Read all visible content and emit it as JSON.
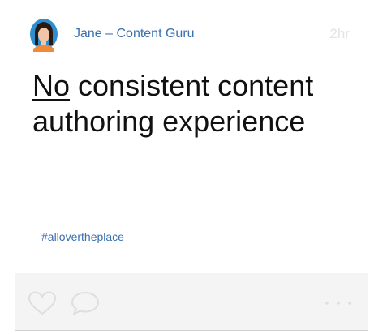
{
  "post": {
    "author": "Jane – Content Guru",
    "time": "2hr",
    "headline_emphasis": "No",
    "headline_rest": " consistent content authoring experience",
    "hashtag": "#allovertheplace"
  },
  "icons": {
    "avatar": "avatar-woman-icon",
    "like": "heart-icon",
    "comment": "speech-bubble-icon",
    "more": "ellipsis-icon"
  },
  "colors": {
    "link": "#3a6fb0",
    "timestamp": "#e3e3e3",
    "footer_background": "#f4f4f4",
    "icon_stroke": "#dedede",
    "avatar_background": "#2e8fd0",
    "avatar_hair": "#2a1a12",
    "avatar_skin": "#f2c5a6",
    "avatar_shirt": "#f08a36"
  }
}
